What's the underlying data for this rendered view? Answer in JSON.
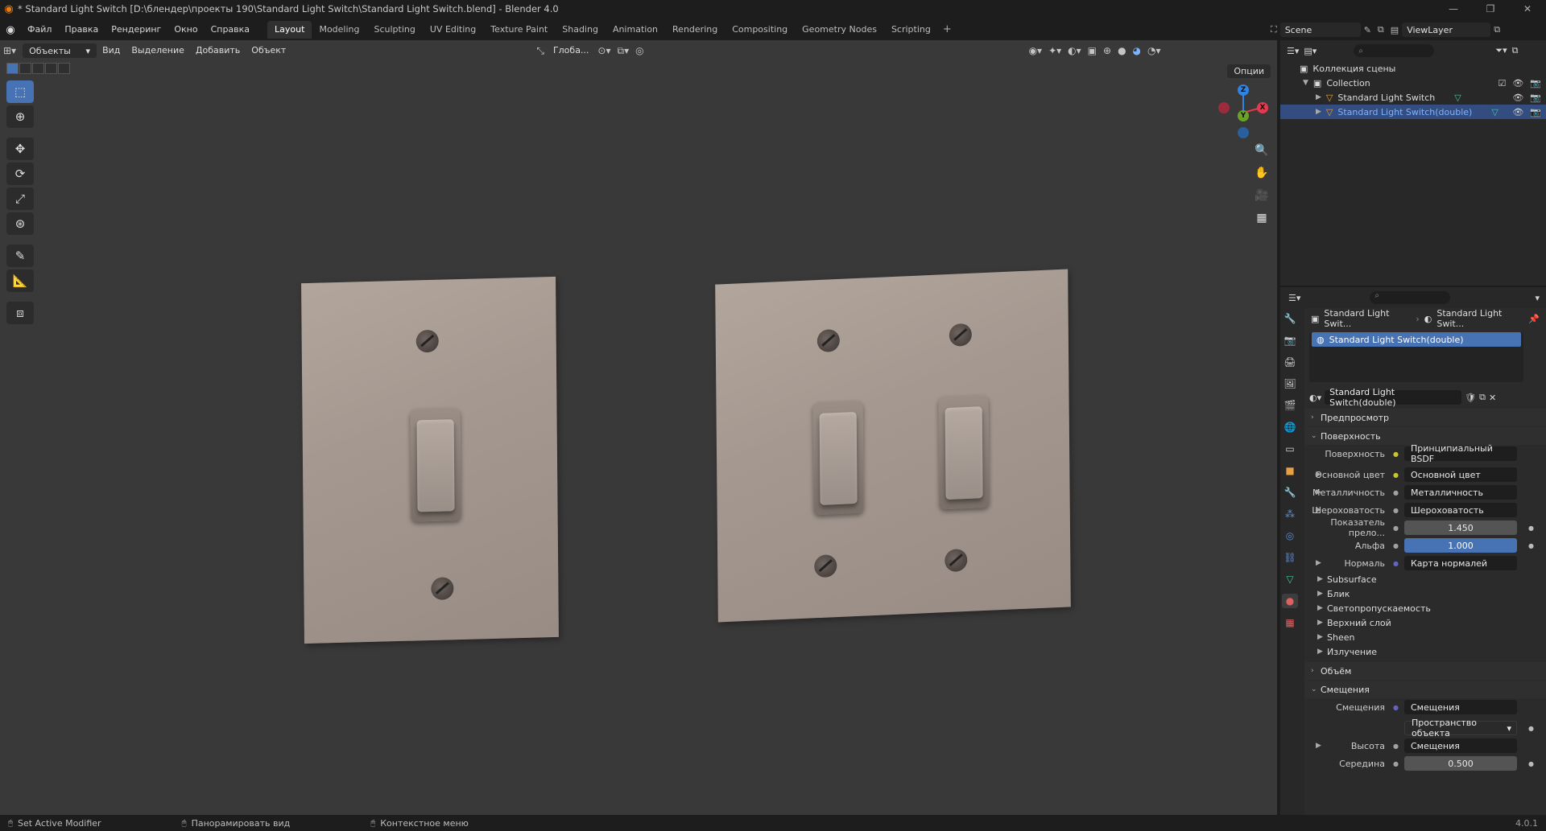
{
  "window": {
    "title": "* Standard Light Switch [D:\\блендер\\проекты 190\\Standard Light Switch\\Standard Light Switch.blend] - Blender 4.0"
  },
  "menu": {
    "items": [
      "Файл",
      "Правка",
      "Рендеринг",
      "Окно",
      "Справка"
    ],
    "workspaces": [
      "Layout",
      "Modeling",
      "Sculpting",
      "UV Editing",
      "Texture Paint",
      "Shading",
      "Animation",
      "Rendering",
      "Compositing",
      "Geometry Nodes",
      "Scripting"
    ],
    "active_workspace": "Layout",
    "scene": "Scene",
    "view_layer": "ViewLayer"
  },
  "viewport": {
    "mode": "Объекты",
    "menus": [
      "Вид",
      "Выделение",
      "Добавить",
      "Объект"
    ],
    "orientation": "Глоба...",
    "options": "Опции"
  },
  "outliner": {
    "root": "Коллекция сцены",
    "collection": "Collection",
    "objects": [
      "Standard Light Switch",
      "Standard Light Switch(double)"
    ]
  },
  "properties": {
    "breadcrumb_object": "Standard Light Swit...",
    "breadcrumb_material": "Standard Light Swit...",
    "slot_name": "Standard Light Switch(double)",
    "material_name": "Standard Light Switch(double)",
    "panels": {
      "preview": "Предпросмотр",
      "surface": "Поверхность",
      "volume": "Объём",
      "displacement": "Смещения"
    },
    "surface_rows": [
      {
        "label": "Поверхность",
        "value": "Принципиальный BSDF"
      },
      {
        "label": "Основной цвет",
        "value": "Основной цвет"
      },
      {
        "label": "Металличность",
        "value": "Металличность"
      },
      {
        "label": "Шероховатость",
        "value": "Шероховатость"
      },
      {
        "label": "Показатель прело...",
        "value": "1.450"
      },
      {
        "label": "Альфа",
        "value": "1.000"
      },
      {
        "label": "Нормаль",
        "value": "Карта нормалей"
      }
    ],
    "subpanels": [
      "Subsurface",
      "Блик",
      "Светопропускаемость",
      "Верхний слой",
      "Sheen",
      "Излучение"
    ],
    "displacement_rows": [
      {
        "label": "Смещения",
        "value": "Смещения"
      },
      {
        "label": "",
        "value": "Пространство объекта"
      },
      {
        "label": "Высота",
        "value": "Смещения"
      },
      {
        "label": "Середина",
        "value": "0.500"
      }
    ]
  },
  "statusbar": {
    "items": [
      "Set Active Modifier",
      "Панорамировать вид",
      "Контекстное меню"
    ],
    "version": "4.0.1"
  }
}
